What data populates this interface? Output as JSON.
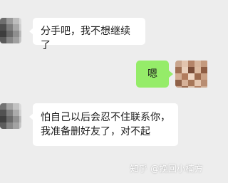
{
  "conversation": {
    "messages": [
      {
        "sender": "contact",
        "text": "分手吧，我不想继续了"
      },
      {
        "sender": "self",
        "text": "嗯"
      },
      {
        "sender": "contact",
        "text": "怕自己以后会忍不住联系你，\n我准备删好友了，对不起"
      }
    ]
  },
  "watermark": {
    "text": "知乎 @挽回小楠方"
  },
  "colors": {
    "background": "#ededed",
    "incoming_bubble": "#ffffff",
    "outgoing_bubble": "#95ec69",
    "text": "#1a1a1a"
  }
}
